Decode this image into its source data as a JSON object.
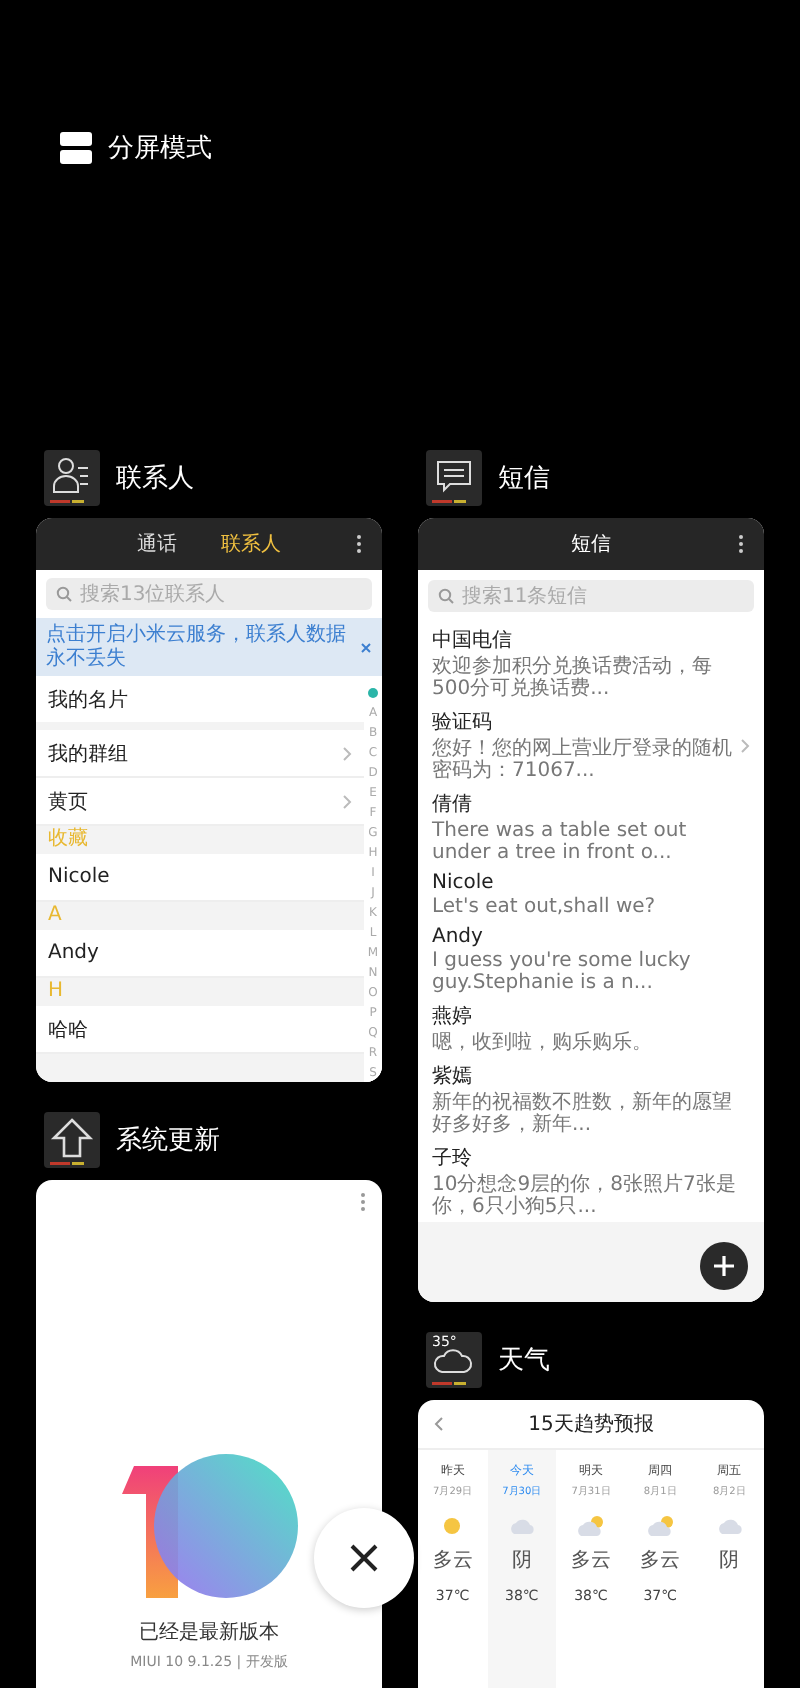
{
  "split_screen": {
    "label": "分屏模式"
  },
  "apps": [
    {
      "kind": "contacts",
      "name": "联系人",
      "tabs": [
        {
          "label": "通话",
          "selected": false
        },
        {
          "label": "联系人",
          "selected": true
        }
      ],
      "search": {
        "placeholder": "搜索13位联系人"
      },
      "banner": "点击开启小米云服务，联系人数据永不丢失",
      "rows": [
        {
          "kind": "card",
          "label": "我的名片"
        },
        {
          "kind": "link",
          "label": "我的群组"
        },
        {
          "kind": "link",
          "label": "黄页"
        },
        {
          "kind": "header",
          "label": "收藏"
        },
        {
          "kind": "contact",
          "label": "Nicole"
        },
        {
          "kind": "header",
          "label": "A"
        },
        {
          "kind": "contact",
          "label": "Andy"
        },
        {
          "kind": "header",
          "label": "H"
        },
        {
          "kind": "contact",
          "label": "哈哈"
        }
      ],
      "index": [
        "A",
        "B",
        "C",
        "D",
        "E",
        "F",
        "G",
        "H",
        "I",
        "J",
        "K",
        "L",
        "M",
        "N",
        "O",
        "P",
        "Q",
        "R",
        "S"
      ]
    },
    {
      "kind": "messages",
      "name": "短信",
      "title": "短信",
      "search": {
        "placeholder": "搜索11条短信"
      },
      "messages": [
        {
          "name": "中国电信",
          "preview": "欢迎参加积分兑换话费活动，每500分可兑换话费...",
          "chevron": false
        },
        {
          "name": "验证码",
          "preview": "您好！您的网上营业厅登录的随机密码为：71067...",
          "chevron": true
        },
        {
          "name": "倩倩",
          "preview": "There was a table set out under a tree in front o...",
          "chevron": false
        },
        {
          "name": "Nicole",
          "preview": "Let's eat out,shall we?",
          "chevron": false
        },
        {
          "name": "Andy",
          "preview": "I guess you're some lucky guy.Stephanie is a n...",
          "chevron": false
        },
        {
          "name": "燕婷",
          "preview": "嗯，收到啦，购乐购乐。",
          "chevron": false
        },
        {
          "name": "紫嫣",
          "preview": "新年的祝福数不胜数，新年的愿望好多好多，新年...",
          "chevron": false
        },
        {
          "name": "子玲",
          "preview": "10分想念9层的你，8张照片7张是你，6只小狗5只...",
          "chevron": false
        }
      ]
    },
    {
      "kind": "update",
      "name": "系统更新",
      "status": "已经是最新版本",
      "version": "MIUI 10 9.1.25 | 开发版"
    },
    {
      "kind": "weather",
      "name": "天气",
      "icon_text": "35°",
      "title": "15天趋势预报",
      "days": [
        {
          "label": "昨天",
          "date": "7月29日",
          "kind": "sunny",
          "condition": "多云",
          "temp": "37℃",
          "selected": false
        },
        {
          "label": "今天",
          "date": "7月30日",
          "kind": "overcast",
          "condition": "阴",
          "temp": "38℃",
          "selected": true
        },
        {
          "label": "明天",
          "date": "7月31日",
          "kind": "partly_cloudy",
          "condition": "多云",
          "temp": "38℃",
          "selected": false
        },
        {
          "label": "周四",
          "date": "8月1日",
          "kind": "partly_cloudy",
          "condition": "多云",
          "temp": "37℃",
          "selected": false
        },
        {
          "label": "周五",
          "date": "8月2日",
          "kind": "overcast",
          "condition": "阴",
          "selected": false
        }
      ]
    }
  ]
}
